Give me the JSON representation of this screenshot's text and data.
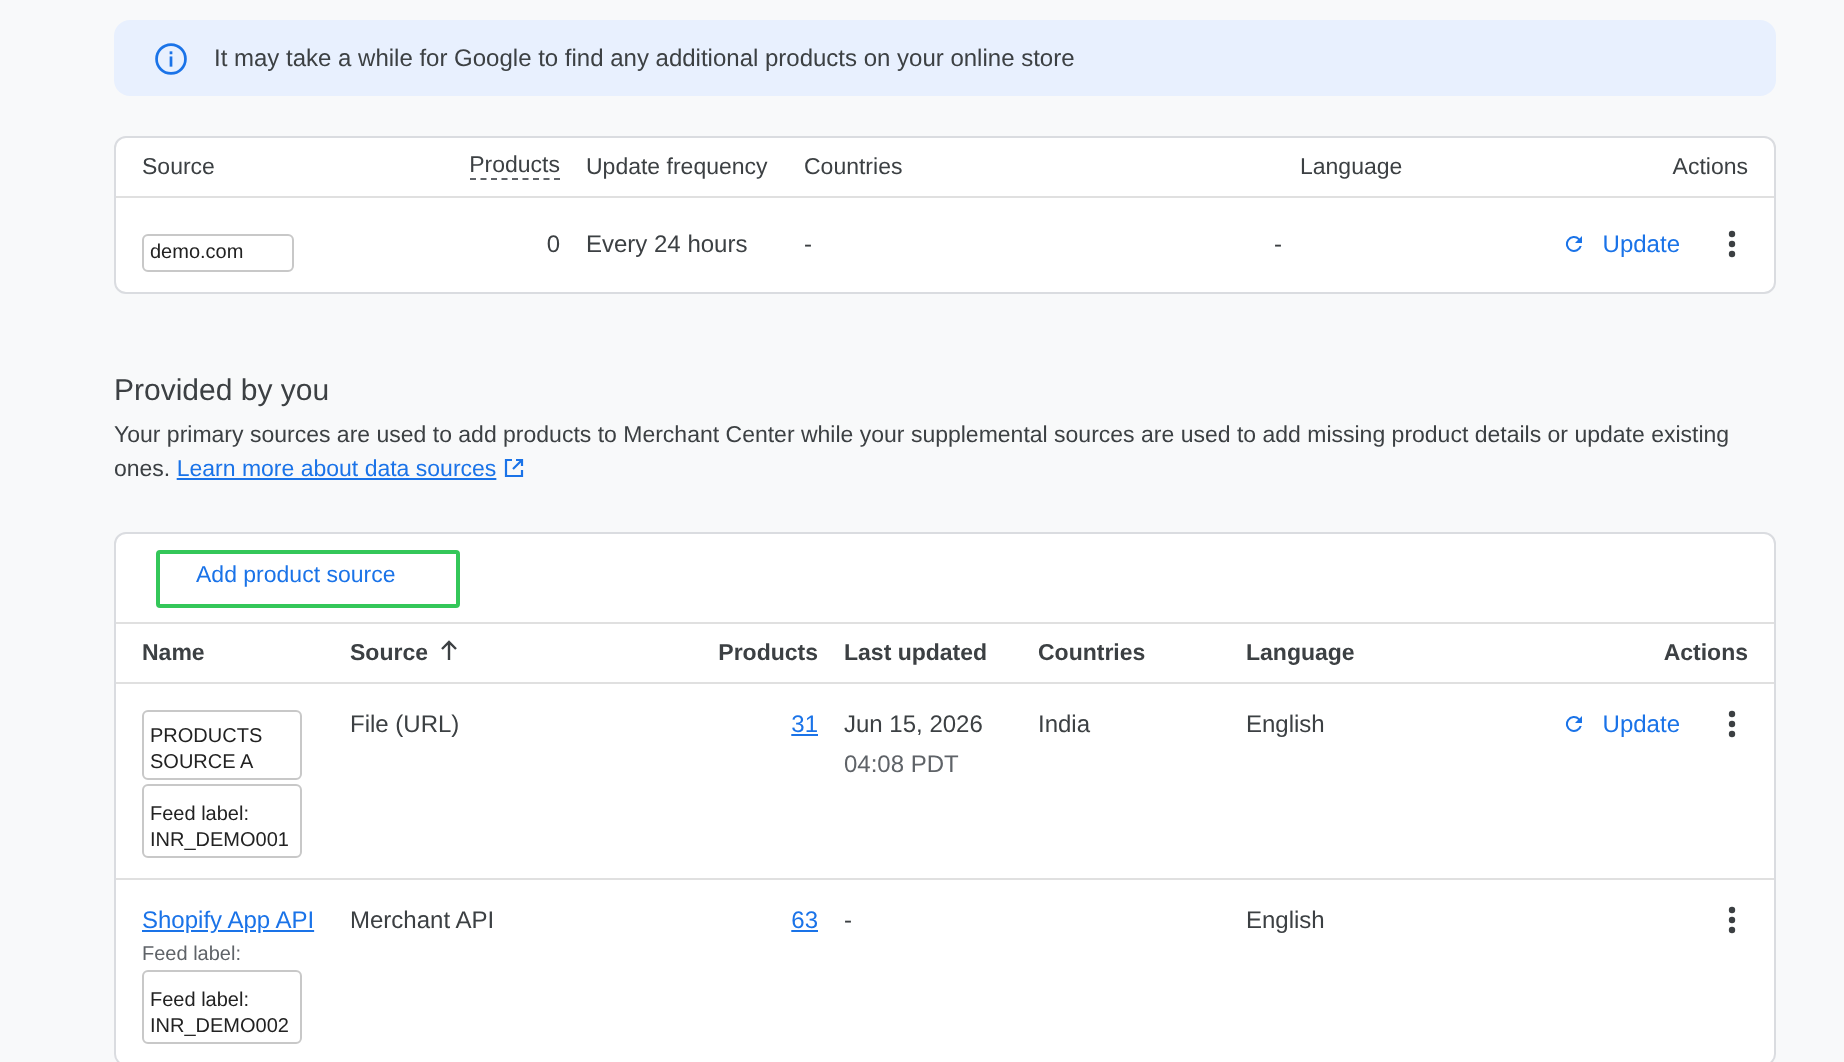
{
  "banner": {
    "text": "It may take a while for Google to find any additional products on your online store"
  },
  "found_sources": {
    "columns": [
      {
        "label": "Source"
      },
      {
        "label": "Products"
      },
      {
        "label": "Update frequency"
      },
      {
        "label": "Countries"
      },
      {
        "label": "Language"
      },
      {
        "label": "Actions"
      }
    ],
    "rows": [
      {
        "source": "demo.com",
        "products": "0",
        "update_frequency": "Every 24 hours",
        "countries": "-",
        "language": "-",
        "action": "Update"
      }
    ]
  },
  "provided": {
    "heading": "Provided by you",
    "description": "Your primary sources are used to add products to Merchant Center while your supplemental sources are used to add missing product details or update existing ones.",
    "link": "Learn more about data sources",
    "add_button": "Add product source",
    "columns": [
      {
        "label": "Name",
        "sorted": false
      },
      {
        "label": "Source",
        "sorted": true
      },
      {
        "label": "Products",
        "sorted": false
      },
      {
        "label": "Last updated",
        "sorted": false
      },
      {
        "label": "Countries",
        "sorted": false
      },
      {
        "label": "Language",
        "sorted": false
      },
      {
        "label": "Actions",
        "sorted": false
      }
    ],
    "rows": [
      {
        "name_link": "",
        "name_box": "PRODUCTS SOURCE A",
        "feed_note": "",
        "feed_box": "Feed label: INR_DEMO001",
        "source": "File (URL)",
        "products": "31",
        "last_updated": "Jun 15, 2026",
        "last_updated_time": "04:08 PDT",
        "countries": "India",
        "language": "English",
        "action": "Update"
      },
      {
        "name_link": "Shopify App API",
        "name_box": "",
        "feed_note": "Feed label:",
        "feed_box": "Feed label: INR_DEMO002",
        "source": "Merchant API",
        "products": "63",
        "last_updated": "-",
        "last_updated_time": "",
        "countries": "",
        "language": "English",
        "action": ""
      }
    ]
  }
}
